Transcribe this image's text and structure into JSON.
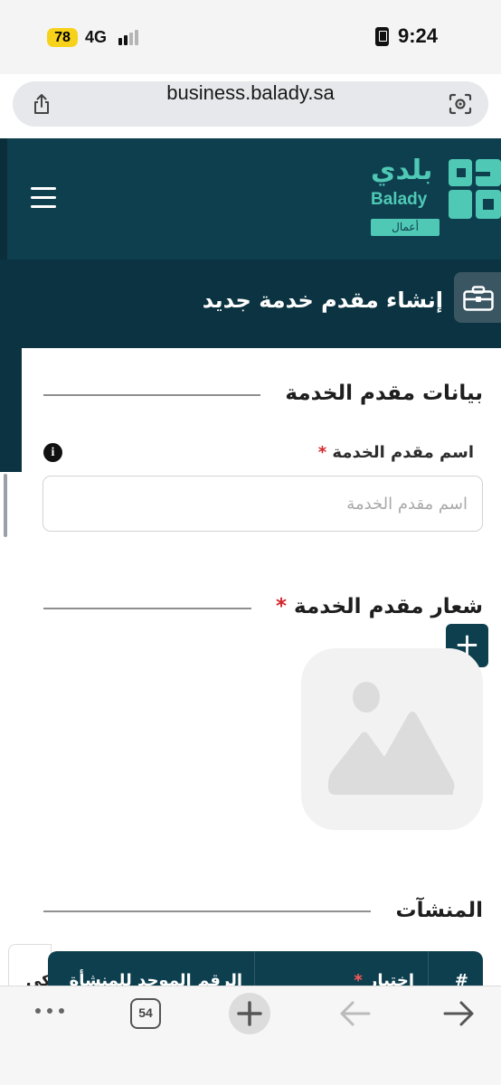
{
  "status_bar": {
    "battery": "78",
    "network": "4G",
    "time": "9:24"
  },
  "browser": {
    "url": "business.balady.sa",
    "tab_count": "54"
  },
  "brand": {
    "name_ar": "بلدي",
    "name_en": "Balady",
    "tag": "أعمال",
    "color": "#4fc9b5"
  },
  "colors": {
    "header": "#0e3f4e",
    "accent": "#4fc9b5",
    "required": "#d3262c"
  },
  "page": {
    "title": "إنشاء مقدم خدمة جديد"
  },
  "sections": {
    "provider_data": {
      "title": "بيانات مقدم الخدمة",
      "name_label": "اسم مقدم الخدمة",
      "required_mark": "*",
      "name_placeholder": "اسم مقدم الخدمة",
      "name_value": ""
    },
    "logo": {
      "title": "شعار مقدم الخدمة",
      "required_mark": "*",
      "add_label": "+"
    },
    "facilities": {
      "title": "المنشآت",
      "columns": [
        "#",
        "اختيار",
        "الرقم الموحد للمنشأة"
      ],
      "select_required_mark": "*",
      "side_tab_label": "كي"
    }
  },
  "icons": [
    "share-icon",
    "camera-lens-icon",
    "menu-icon",
    "briefcase-icon",
    "info-icon",
    "image-placeholder-icon",
    "plus-icon",
    "more-icon",
    "back-arrow-icon",
    "forward-arrow-icon"
  ]
}
